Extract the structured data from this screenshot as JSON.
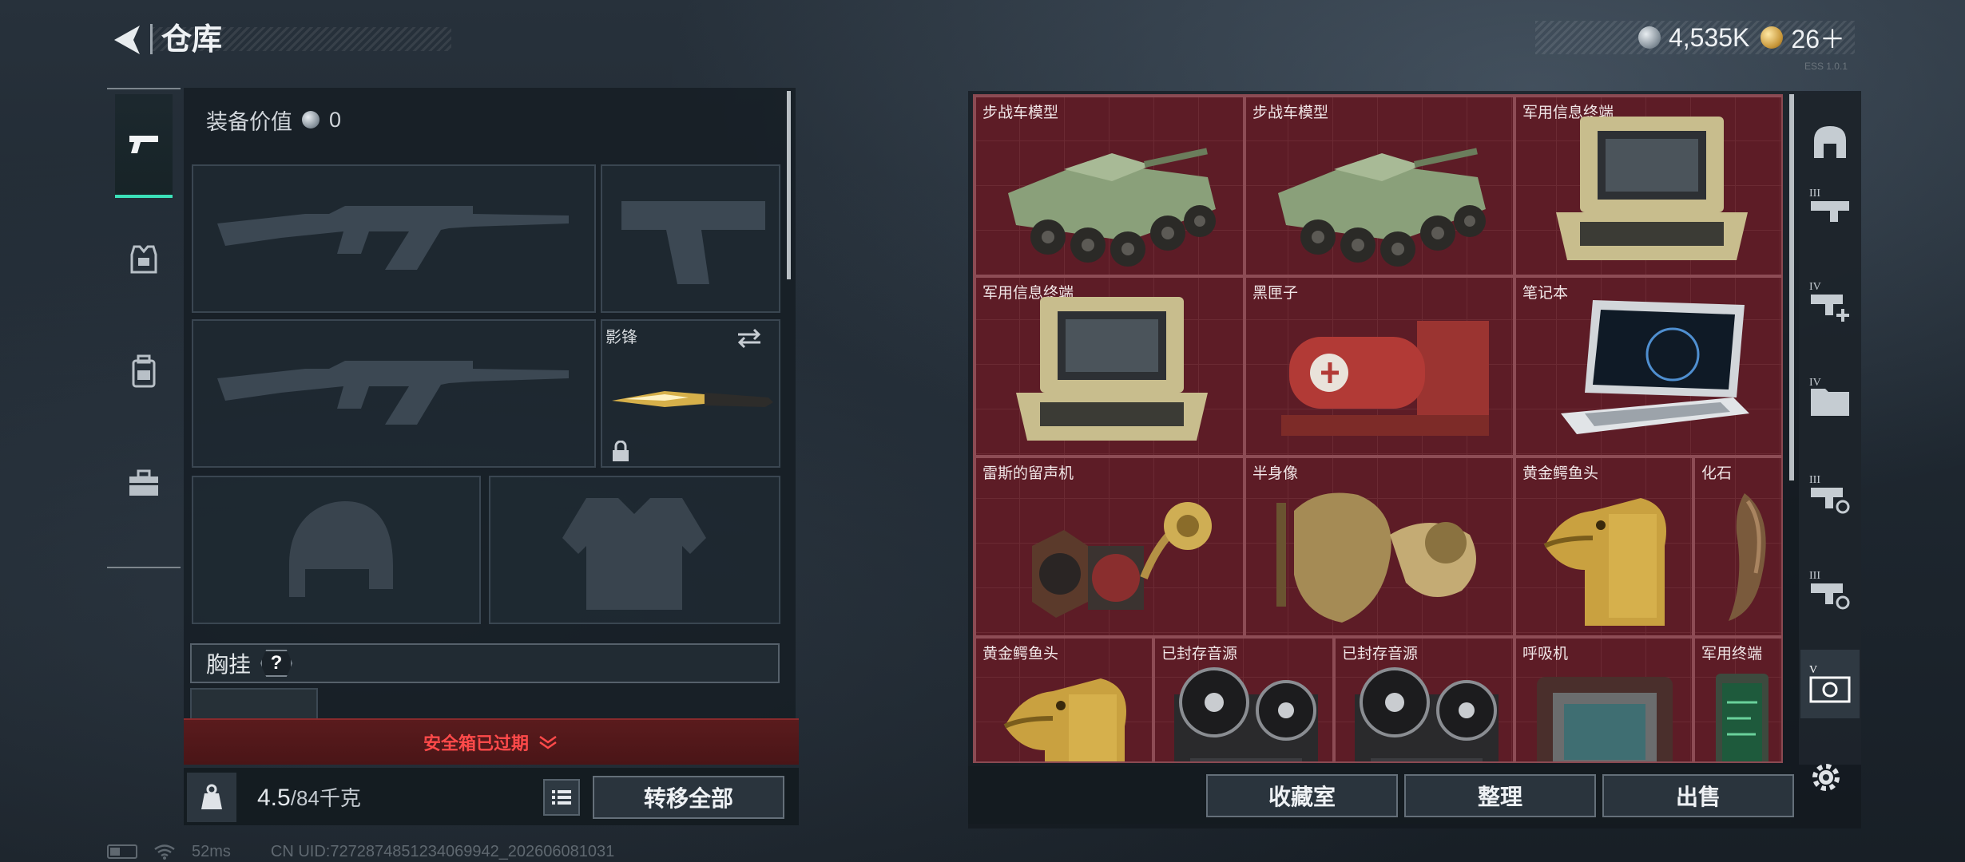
{
  "header": {
    "title": "仓库",
    "back_icon": "back-arrow-icon",
    "silver_amount": "4,535K",
    "gold_amount": "26＋",
    "version_text": "ESS 1.0.1"
  },
  "side_nav": {
    "items": [
      {
        "name": "weapons",
        "icon": "pistol-icon",
        "active": true
      },
      {
        "name": "armor",
        "icon": "armor-icon",
        "active": false
      },
      {
        "name": "backpack",
        "icon": "backpack-icon",
        "active": false
      },
      {
        "name": "toolbox",
        "icon": "toolbox-icon",
        "active": false
      }
    ]
  },
  "equipment": {
    "value_label": "装备价值",
    "value": "0",
    "knife_label": "影锋",
    "chest_label": "胸挂",
    "help_mark": "?",
    "safe_box_text": "安全箱已过期",
    "weight_current": "4.5",
    "weight_max": "/84千克",
    "transfer_all": "转移全部"
  },
  "inventory": {
    "items": [
      {
        "label": "步战车模型",
        "kind": "ifv"
      },
      {
        "label": "步战车模型",
        "kind": "ifv"
      },
      {
        "label": "军用信息终端",
        "kind": "terminal"
      },
      {
        "label": "军用信息终端",
        "kind": "terminal"
      },
      {
        "label": "黑匣子",
        "kind": "blackbox"
      },
      {
        "label": "笔记本",
        "kind": "laptop"
      },
      {
        "label": "雷斯的留声机",
        "kind": "gramophone"
      },
      {
        "label": "半身像",
        "kind": "bust"
      },
      {
        "label": "黄金鳄鱼头",
        "kind": "croc"
      },
      {
        "label": "化石",
        "kind": "fossil"
      },
      {
        "label": "黄金鳄鱼头",
        "kind": "croc"
      },
      {
        "label": "已封存音源",
        "kind": "reel"
      },
      {
        "label": "已封存音源",
        "kind": "reel"
      },
      {
        "label": "呼吸机",
        "kind": "ventilator"
      },
      {
        "label": "军用终端",
        "kind": "tablet"
      }
    ],
    "buttons": {
      "collection": "收藏室",
      "organize": "整理",
      "sell": "出售"
    }
  },
  "categories": [
    {
      "icon": "armor-locker-icon",
      "tier": ""
    },
    {
      "icon": "gun-tier3-icon",
      "tier": "III"
    },
    {
      "icon": "gun-add-tier4-icon",
      "tier": "IV"
    },
    {
      "icon": "folder-tier4-icon",
      "tier": "IV"
    },
    {
      "icon": "gun-search-tier3-icon",
      "tier": "III"
    },
    {
      "icon": "gun-search-tier3b-icon",
      "tier": "III"
    },
    {
      "icon": "camera-icon",
      "tier": "V"
    }
  ],
  "status": {
    "ping": "52ms",
    "uid": "CN UID:7272874851234069942_202606081031"
  },
  "colors": {
    "accent": "#3be0b8",
    "danger": "#ff4a4a",
    "grid_bg": "#5b1c24"
  }
}
